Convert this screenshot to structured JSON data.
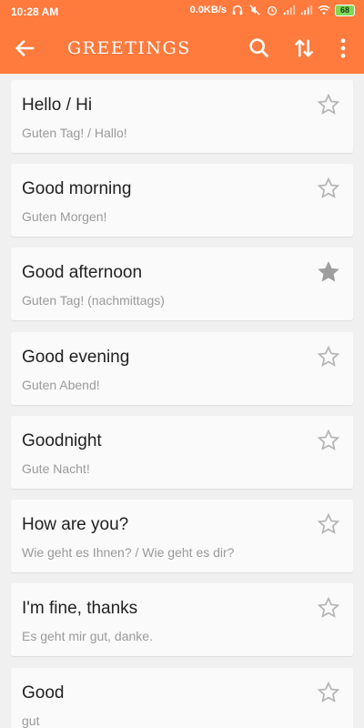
{
  "status": {
    "time": "10:28 AM",
    "speed": "0.0KB/s",
    "battery": "68"
  },
  "appbar": {
    "title": "GREETINGS",
    "icons": {
      "back": "back-arrow-icon",
      "search": "search-icon",
      "swap": "swap-vert-icon",
      "more": "more-vert-icon"
    }
  },
  "colors": {
    "accent": "#ff7a3d",
    "star_empty": "#b5b5b5",
    "star_filled": "#9e9e9e"
  },
  "phrases": [
    {
      "en": "Hello / Hi",
      "de": "Guten Tag! / Hallo!",
      "favorite": false
    },
    {
      "en": "Good morning",
      "de": "Guten Morgen!",
      "favorite": false
    },
    {
      "en": "Good afternoon",
      "de": "Guten Tag! (nachmittags)",
      "favorite": true
    },
    {
      "en": "Good evening",
      "de": "Guten Abend!",
      "favorite": false
    },
    {
      "en": "Goodnight",
      "de": "Gute Nacht!",
      "favorite": false
    },
    {
      "en": "How are you?",
      "de": "Wie geht es Ihnen? / Wie geht es dir?",
      "favorite": false
    },
    {
      "en": "I'm fine, thanks",
      "de": "Es geht mir gut, danke.",
      "favorite": false
    },
    {
      "en": "Good",
      "de": "gut",
      "favorite": false
    }
  ]
}
